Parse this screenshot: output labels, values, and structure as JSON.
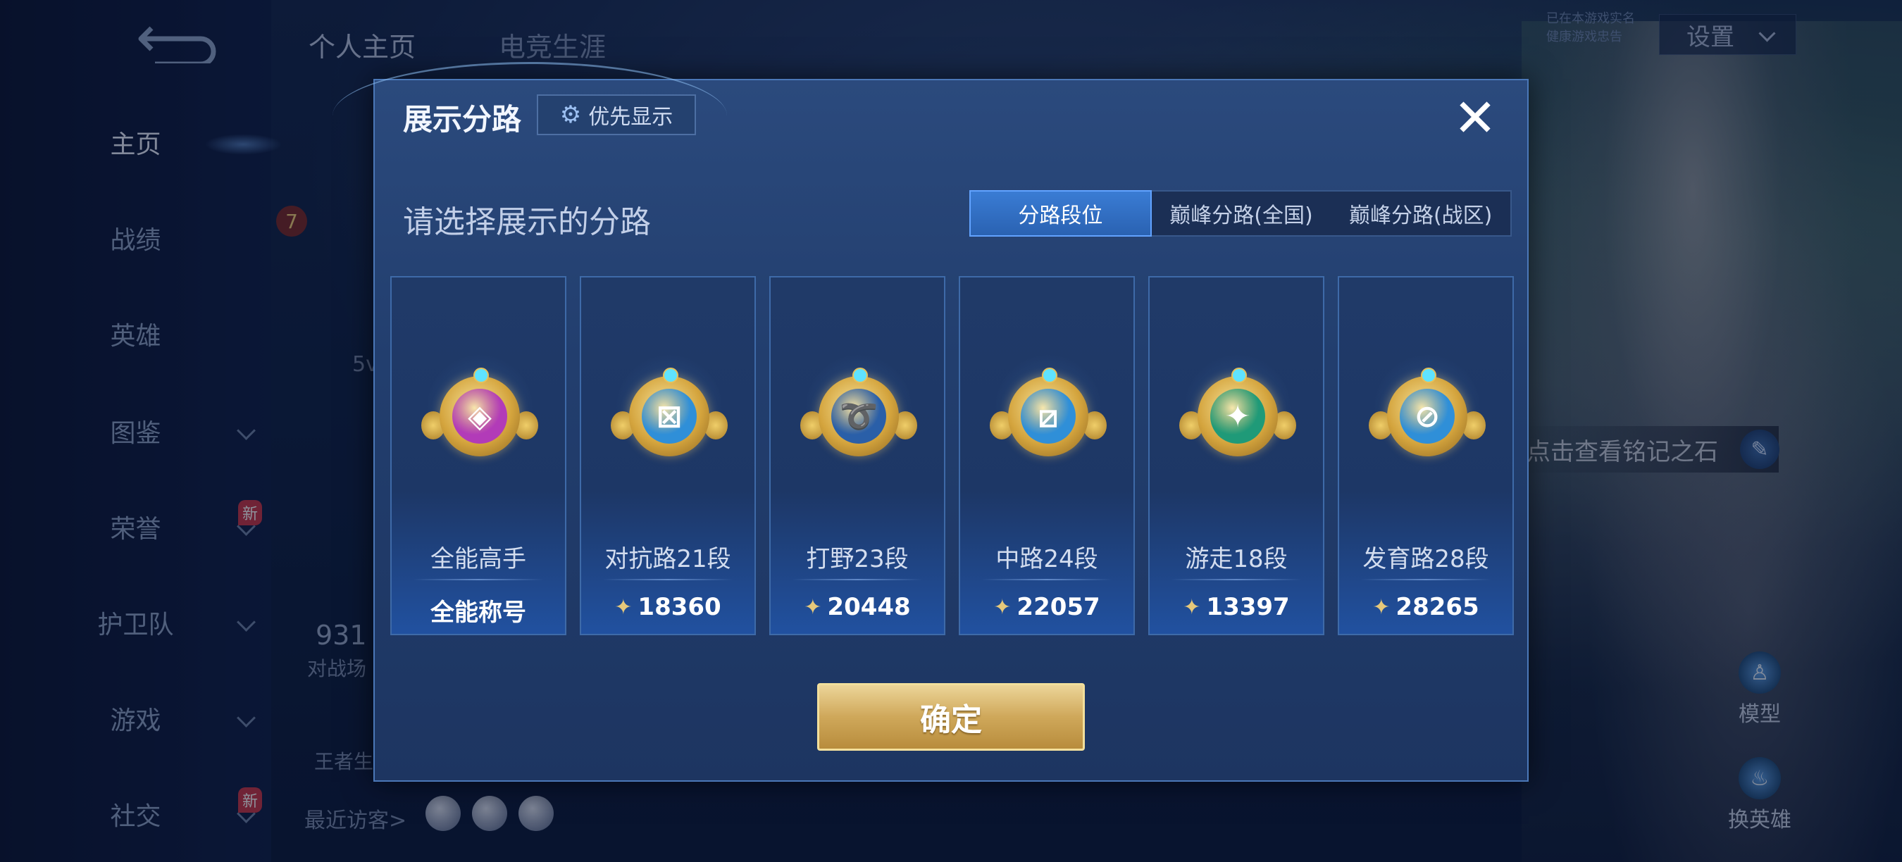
{
  "left_nav": {
    "items": [
      {
        "label": "主页",
        "active": true
      },
      {
        "label": "战绩"
      },
      {
        "label": "英雄"
      },
      {
        "label": "图鉴",
        "chevron": true
      },
      {
        "label": "荣誉",
        "chevron": true,
        "badge": "新"
      },
      {
        "label": "护卫队",
        "chevron": true
      },
      {
        "label": "游戏",
        "chevron": true
      },
      {
        "label": "社交",
        "chevron": true,
        "badge": "新"
      }
    ]
  },
  "top_tabs": [
    "个人主页",
    "电竞生涯"
  ],
  "anti_addiction": [
    "已在本游戏实名",
    "健康游戏忠告"
  ],
  "settings": {
    "label": "设置"
  },
  "background": {
    "level_badge": "7",
    "stat_prefix": "931",
    "stat_label": "对战场",
    "frag_5v": "5v",
    "frag_wangzhe": "王者生",
    "recent_visitors": "最近访客>",
    "stone_hint": "点击查看铭记之石",
    "right_buttons": [
      {
        "label": "模型"
      },
      {
        "label": "换英雄"
      }
    ]
  },
  "modal": {
    "title": "展示分路",
    "priority_button": "优先显示",
    "prompt": "请选择展示的分路",
    "tabs": [
      {
        "label": "分路段位",
        "active": true
      },
      {
        "label": "巅峰分路(全国)"
      },
      {
        "label": "巅峰分路(战区)"
      }
    ],
    "cards": [
      {
        "name": "全能高手",
        "value": "全能称号",
        "has_star": false,
        "emblem_color": "#b23bb8",
        "glyph": "◈"
      },
      {
        "name": "对抗路21段",
        "value": "18360",
        "has_star": true,
        "emblem_color": "#2f8fd8",
        "glyph": "⊠"
      },
      {
        "name": "打野23段",
        "value": "20448",
        "has_star": true,
        "emblem_color": "#2a5fa8",
        "glyph": "➰"
      },
      {
        "name": "中路24段",
        "value": "22057",
        "has_star": true,
        "emblem_color": "#2f8fd8",
        "glyph": "⧄"
      },
      {
        "name": "游走18段",
        "value": "13397",
        "has_star": true,
        "emblem_color": "#1f9a78",
        "glyph": "✦"
      },
      {
        "name": "发育路28段",
        "value": "28265",
        "has_star": true,
        "emblem_color": "#2f8fd8",
        "glyph": "⊘"
      }
    ],
    "confirm": "确定"
  },
  "colors": {
    "modal_bg": "#223e6e",
    "accent_blue": "#3a7cd4",
    "gold": "#cfa85a"
  }
}
